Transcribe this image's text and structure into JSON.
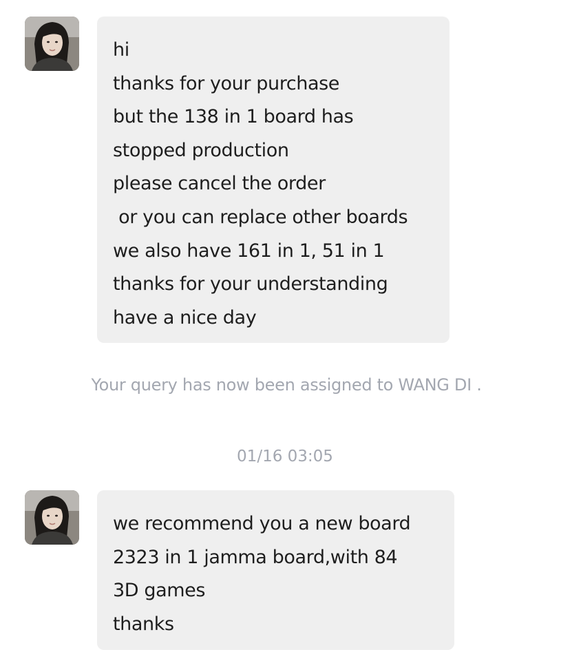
{
  "messages": [
    {
      "sender_avatar": "agent-avatar",
      "lines": [
        "hi",
        "thanks for your purchase",
        "but the 138 in 1 board has",
        "stopped production",
        "please cancel the order",
        " or you can replace other boards",
        "we also have 161 in 1, 51 in 1",
        "thanks for your understanding",
        "have a nice day"
      ]
    },
    {
      "sender_avatar": "agent-avatar",
      "lines": [
        "we recommend you a new board",
        "2323 in 1 jamma board,with 84",
        "3D games",
        "thanks"
      ]
    }
  ],
  "system_note": "Your query has now been assigned to WANG DI .",
  "timestamp": "01/16 03:05",
  "colors": {
    "bubble_bg": "#efefef",
    "text": "#1e1e1e",
    "muted": "#a3a7b0"
  }
}
